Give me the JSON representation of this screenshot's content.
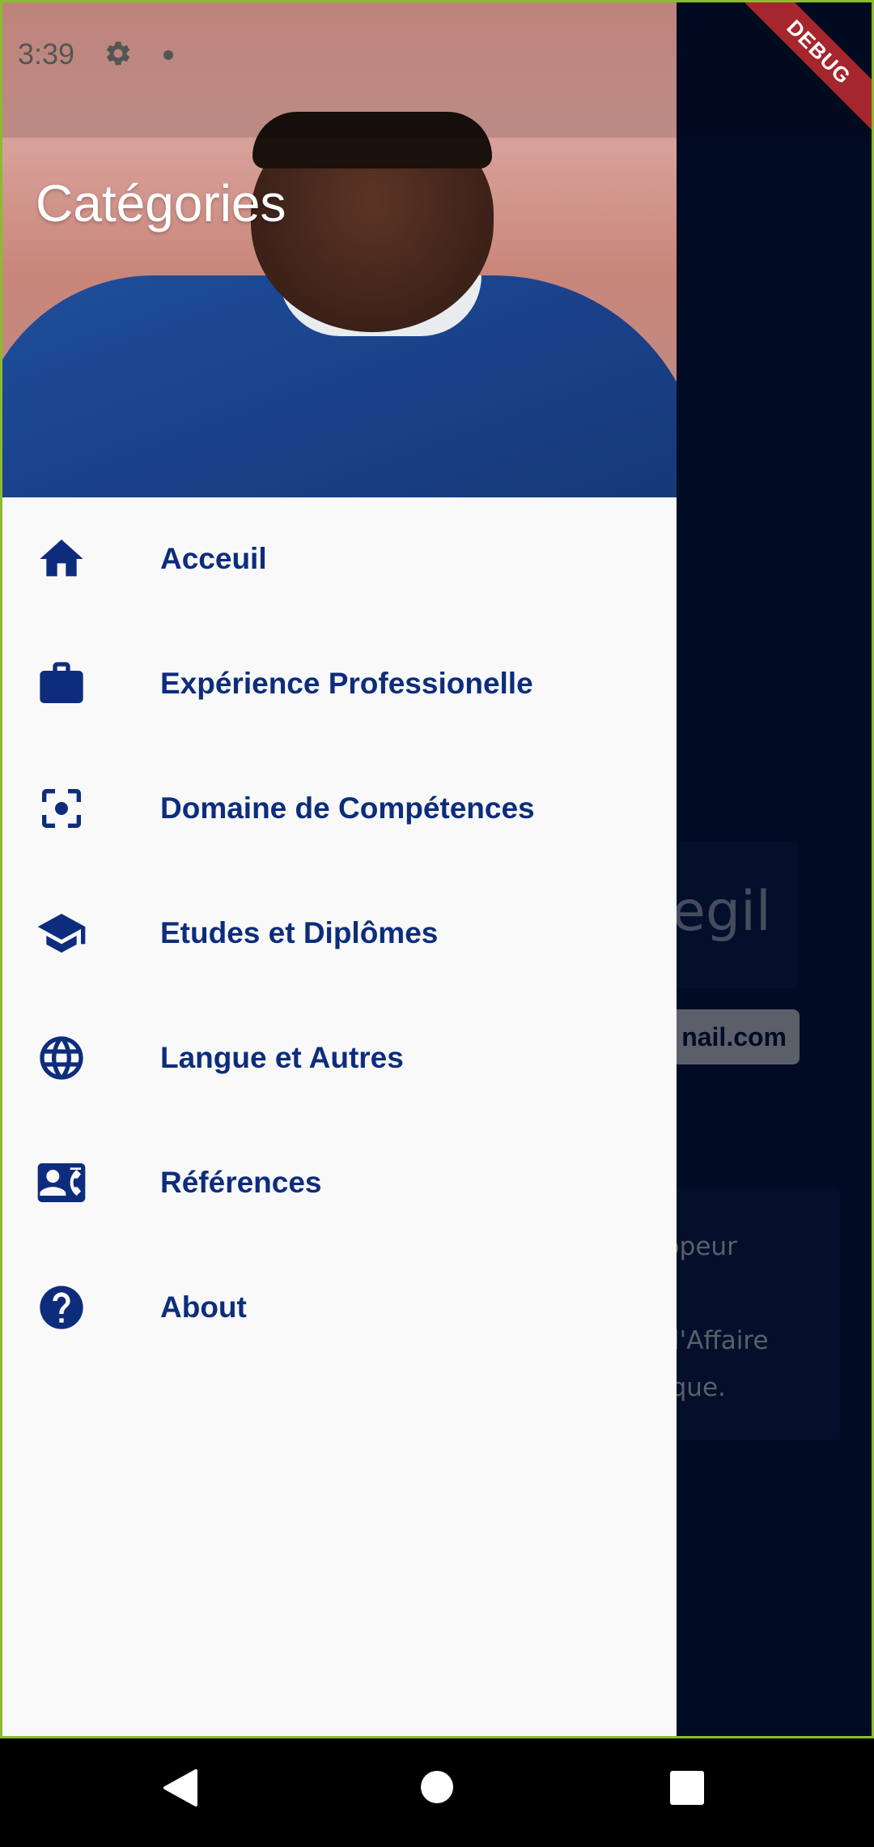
{
  "status_bar": {
    "time": "3:39"
  },
  "debug_banner": "DEBUG",
  "background_page": {
    "name_fragment": "egil",
    "email_fragment": "nail.com",
    "description_lines": [
      "ppeur",
      "",
      "d'Affaire",
      "ique."
    ]
  },
  "drawer": {
    "title": "Catégories",
    "items": [
      {
        "label": "Acceuil",
        "icon": "home-icon"
      },
      {
        "label": "Expérience Professionelle",
        "icon": "briefcase-icon"
      },
      {
        "label": "Domaine de Compétences",
        "icon": "center-focus-icon"
      },
      {
        "label": "Etudes et Diplômes",
        "icon": "school-icon"
      },
      {
        "label": "Langue et Autres",
        "icon": "globe-icon"
      },
      {
        "label": "Références",
        "icon": "contact-mail-icon"
      },
      {
        "label": "About",
        "icon": "help-icon"
      }
    ]
  },
  "colors": {
    "accent": "#0d2d7c",
    "drawer_bg": "#f9f9f9",
    "page_bg": "#041238"
  }
}
